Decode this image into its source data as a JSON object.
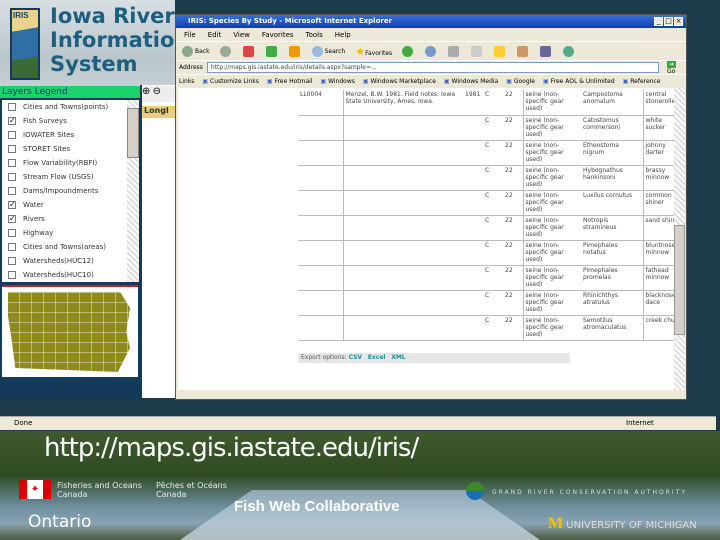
{
  "iris": {
    "logo_text": "IRIS",
    "title_lines": [
      "Iowa River",
      "Information",
      "System"
    ]
  },
  "legend": {
    "title": "Layers Legend",
    "items": [
      {
        "label": "Cities and Towns(points)",
        "checked": false
      },
      {
        "label": "Fish Surveys",
        "checked": true
      },
      {
        "label": "IOWATER Sites",
        "checked": false
      },
      {
        "label": "STORET Sites",
        "checked": false
      },
      {
        "label": "Flow Variability(RBFI)",
        "checked": false
      },
      {
        "label": "Stream Flow (USGS)",
        "checked": false
      },
      {
        "label": "Dams/Impoundments",
        "checked": false
      },
      {
        "label": "Water",
        "checked": true
      },
      {
        "label": "Rivers",
        "checked": true
      },
      {
        "label": "Highway",
        "checked": false
      },
      {
        "label": "Cities and Towns(areas)",
        "checked": false
      },
      {
        "label": "Watersheds(HUC12)",
        "checked": false
      },
      {
        "label": "Watersheds(HUC10)",
        "checked": false
      }
    ]
  },
  "map_panel": {
    "header": "Longl"
  },
  "browser": {
    "title": "IRIS: Species By Study - Microsoft Internet Explorer",
    "menu": [
      "File",
      "Edit",
      "View",
      "Favorites",
      "Tools",
      "Help"
    ],
    "toolbar": {
      "back": "Back",
      "search": "Search",
      "favorites": "Favorites"
    },
    "address_label": "Address",
    "address": "http://maps.gis.iastate.edu/iris/details.aspx?sample=...",
    "go": "Go",
    "links_label": "Links",
    "links": [
      "Customize Links",
      "Free Hotmail",
      "Windows",
      "Windows Marketplace",
      "Windows Media",
      "Google",
      "Free AOL & Unlimited",
      "Reference"
    ],
    "status": "Done",
    "zone": "Internet"
  },
  "table": {
    "study_id": "LL0004",
    "reference": "Menzel, B.W. 1981. Field notes: Iowa State University, Ames, Iowa.",
    "year": "1981",
    "rows": [
      {
        "c": "C",
        "n": "22",
        "gear": "seine (non-specific gear used)",
        "sci": "Campostoma anomalum",
        "common": "central stoneroller"
      },
      {
        "c": "C",
        "n": "22",
        "gear": "seine (non-specific gear used)",
        "sci": "Catostomus commersoni",
        "common": "white sucker"
      },
      {
        "c": "C",
        "n": "22",
        "gear": "seine (non-specific gear used)",
        "sci": "Etheostoma nigrum",
        "common": "johnny darter"
      },
      {
        "c": "C",
        "n": "22",
        "gear": "seine (non-specific gear used)",
        "sci": "Hybognathus hankinsoni",
        "common": "brassy minnow"
      },
      {
        "c": "C",
        "n": "22",
        "gear": "seine (non-specific gear used)",
        "sci": "Luxilus cornutus",
        "common": "common shiner"
      },
      {
        "c": "C",
        "n": "22",
        "gear": "seine (non-specific gear used)",
        "sci": "Notropis stramineus",
        "common": "sand shiner"
      },
      {
        "c": "C",
        "n": "22",
        "gear": "seine (non-specific gear used)",
        "sci": "Pimephales notatus",
        "common": "bluntnose minnow"
      },
      {
        "c": "C",
        "n": "22",
        "gear": "seine (non-specific gear used)",
        "sci": "Pimephales promelas",
        "common": "fathead minnow"
      },
      {
        "c": "C",
        "n": "22",
        "gear": "seine (non-specific gear used)",
        "sci": "Rhinichthys atratulus",
        "common": "blacknose dace"
      },
      {
        "c": "C",
        "n": "22",
        "gear": "seine (non-specific gear used)",
        "sci": "Semotilus atromaculatus",
        "common": "creek chub"
      }
    ]
  },
  "export": {
    "label": "Export options:",
    "csv": "CSV",
    "excel": "Excel",
    "xml": "XML"
  },
  "slide": {
    "url": "http://maps.gis.iastate.edu/iris/",
    "dfo_en": "Fisheries and Oceans Canada",
    "dfo_fr": "Pêches et Océans Canada",
    "title": "Fish Web Collaborative",
    "grca": "GRAND RIVER CONSERVATION AUTHORITY",
    "ontario": "Ontario",
    "michigan": "UNIVERSITY OF MICHIGAN",
    "michigan_m": "M"
  }
}
